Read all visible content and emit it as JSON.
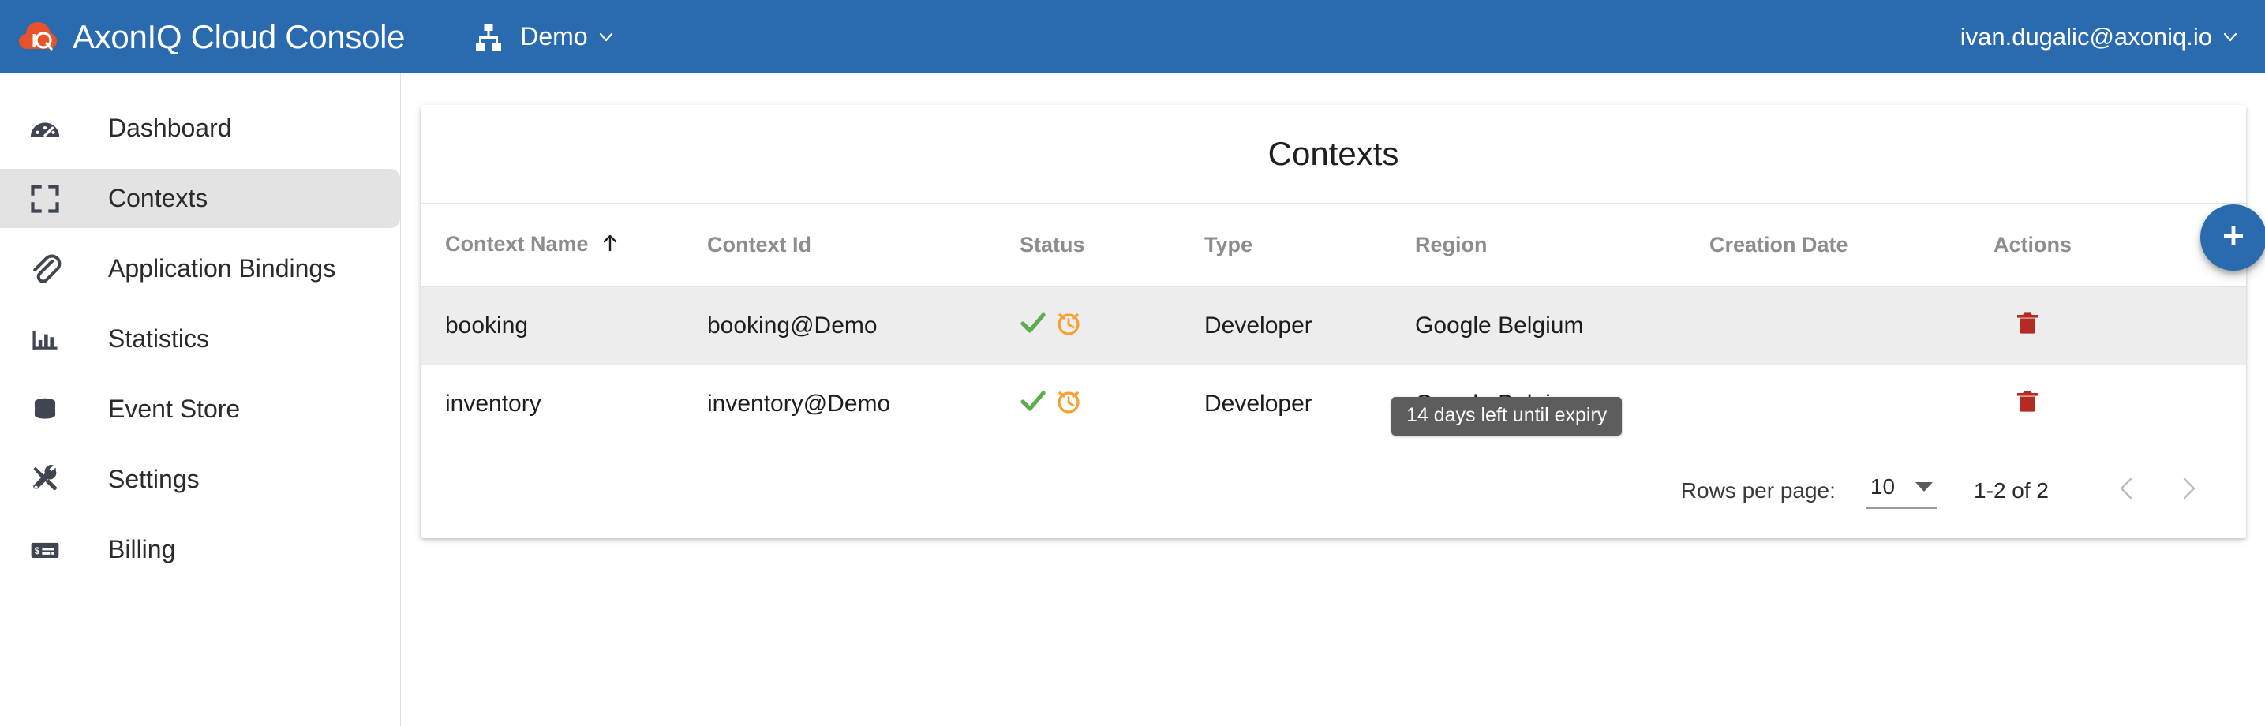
{
  "topbar": {
    "logo_icon": "axoniq-cloud-logo-icon",
    "brand_title": "AxonIQ Cloud Console",
    "org_icon": "hierarchy-icon",
    "org_label": "Demo",
    "org_chevron_icon": "chevron-down-icon",
    "user_email": "ivan.dugalic@axoniq.io",
    "user_chevron_icon": "chevron-down-icon",
    "background_color": "#2a6bb0"
  },
  "sidebar": {
    "items": [
      {
        "label": "Dashboard",
        "icon": "gauge-icon",
        "active": false
      },
      {
        "label": "Contexts",
        "icon": "fullscreen-icon",
        "active": true
      },
      {
        "label": "Application Bindings",
        "icon": "paperclip-icon",
        "active": false
      },
      {
        "label": "Statistics",
        "icon": "bar-chart-icon",
        "active": false
      },
      {
        "label": "Event Store",
        "icon": "database-icon",
        "active": false
      },
      {
        "label": "Settings",
        "icon": "tools-icon",
        "active": false
      },
      {
        "label": "Billing",
        "icon": "payment-icon",
        "active": false
      }
    ],
    "active_background": "#e3e3e3"
  },
  "main": {
    "card_title": "Contexts",
    "add_button_icon": "plus-icon",
    "add_button_color": "#2a6bb0",
    "table": {
      "columns": [
        {
          "label": "Context Name",
          "sorted": true,
          "sort_direction": "asc",
          "sort_icon": "arrow-up-icon"
        },
        {
          "label": "Context Id",
          "sorted": false
        },
        {
          "label": "Status",
          "sorted": false
        },
        {
          "label": "Type",
          "sorted": false
        },
        {
          "label": "Region",
          "sorted": false
        },
        {
          "label": "Creation Date",
          "sorted": false
        },
        {
          "label": "Actions",
          "sorted": false
        }
      ],
      "rows": [
        {
          "context_name": "booking",
          "context_id": "booking@Demo",
          "status_icons": [
            "check-icon",
            "alarm-clock-icon"
          ],
          "type": "Developer",
          "region": "Google Belgium",
          "creation_date": "",
          "action_icon": "delete-icon",
          "hovered": true
        },
        {
          "context_name": "inventory",
          "context_id": "inventory@Demo",
          "status_icons": [
            "check-icon",
            "alarm-clock-icon"
          ],
          "type": "Developer",
          "region": "Google Belgium",
          "creation_date": "",
          "action_icon": "delete-icon",
          "hovered": false
        }
      ]
    },
    "tooltip": {
      "text": "14 days left until expiry",
      "background_color": "#5d5d5d"
    },
    "paginator": {
      "rows_per_page_label": "Rows per page:",
      "rows_per_page_value": "10",
      "dropdown_icon": "caret-down-icon",
      "range_label": "1-2 of 2",
      "prev_icon": "chevron-left-icon",
      "next_icon": "chevron-right-icon"
    }
  },
  "colors": {
    "brand_blue": "#2a6bb0",
    "logo_orange": "#e8512a",
    "status_ok_green": "#5fab52",
    "status_warn_orange": "#f5a030",
    "delete_red": "#b32b22"
  }
}
